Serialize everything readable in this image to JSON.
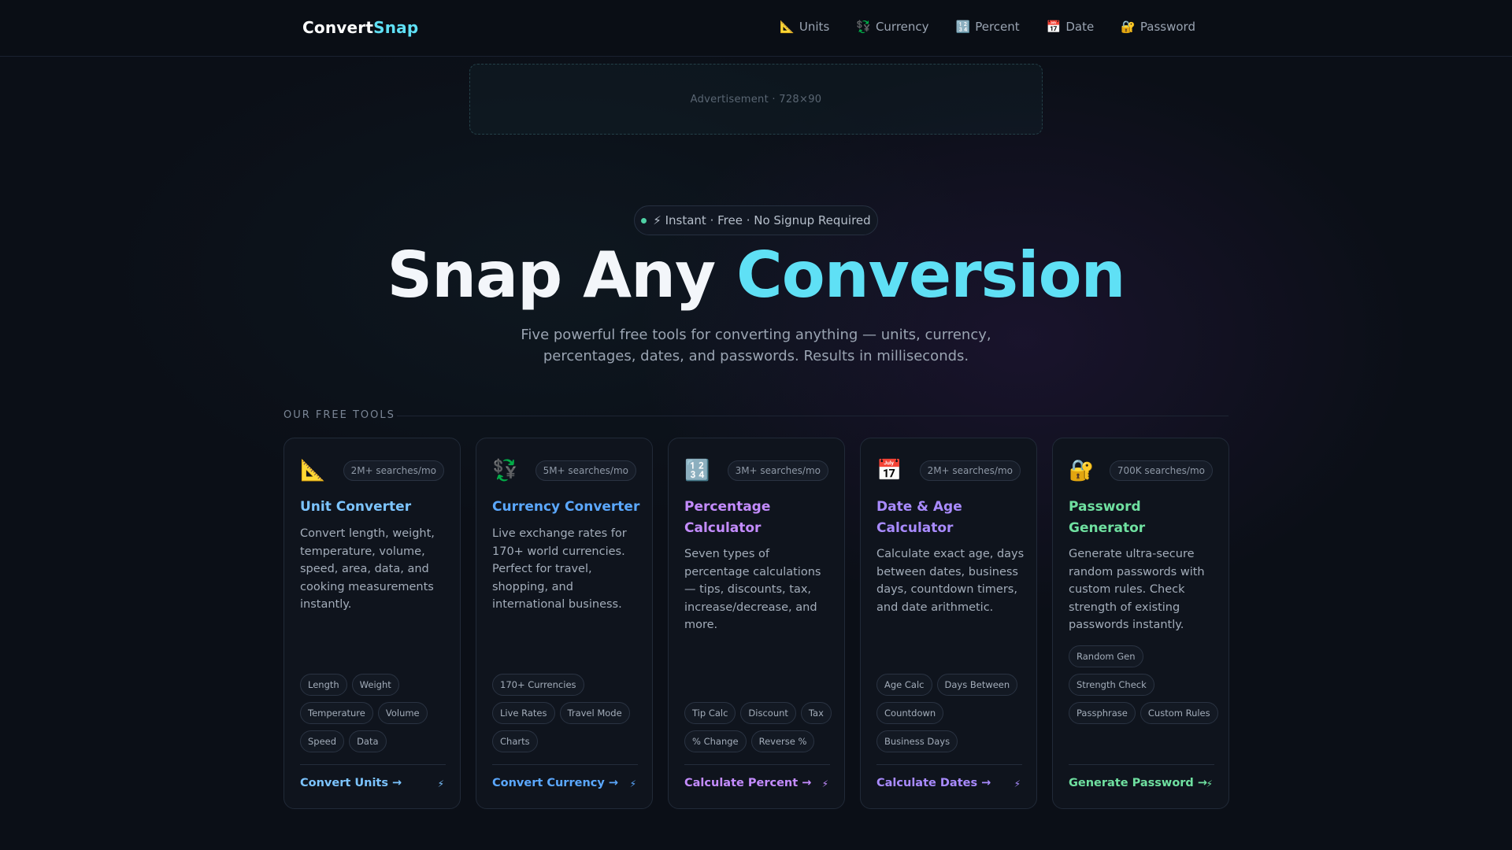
{
  "brand": {
    "part1": "Convert",
    "part2": "Snap"
  },
  "nav": [
    {
      "icon": "📐",
      "label": "Units"
    },
    {
      "icon": "💱",
      "label": "Currency"
    },
    {
      "icon": "🔢",
      "label": "Percent"
    },
    {
      "icon": "📅",
      "label": "Date"
    },
    {
      "icon": "🔐",
      "label": "Password"
    }
  ],
  "ad": {
    "label": "Advertisement · 728×90"
  },
  "hero": {
    "pill": "⚡ Instant · Free · No Signup Required",
    "title_part1": "Snap Any ",
    "title_part2": "Conversion",
    "subtitle": "Five powerful free tools for converting anything — units, currency, percentages, dates, and passwords. Results in milliseconds."
  },
  "section": {
    "label": "OUR FREE TOOLS"
  },
  "colors": {
    "cyan": "#5fe0f5",
    "unit": "#7cc4ff",
    "currency": "#5ba8ff",
    "percent": "#c48cff",
    "date": "#a98bff",
    "password": "#6fe0a0"
  },
  "cards": [
    {
      "icon": "📐",
      "badge": "2M+ searches/mo",
      "title": "Unit Converter",
      "desc": "Convert length, weight, temperature, volume, speed, area, data, and cooking measurements instantly.",
      "tags": [
        "Length",
        "Weight",
        "Temperature",
        "Volume",
        "Speed",
        "Data"
      ],
      "cta": "Convert Units →",
      "bolt": "⚡"
    },
    {
      "icon": "💱",
      "badge": "5M+ searches/mo",
      "title": "Currency Converter",
      "desc": "Live exchange rates for 170+ world currencies. Perfect for travel, shopping, and international business.",
      "tags": [
        "170+ Currencies",
        "Live Rates",
        "Travel Mode",
        "Charts"
      ],
      "cta": "Convert Currency →",
      "bolt": "⚡"
    },
    {
      "icon": "🔢",
      "badge": "3M+ searches/mo",
      "title": "Percentage Calculator",
      "desc": "Seven types of percentage calculations — tips, discounts, tax, increase/decrease, and more.",
      "tags": [
        "Tip Calc",
        "Discount",
        "Tax",
        "% Change",
        "Reverse %"
      ],
      "cta": "Calculate Percent →",
      "bolt": "⚡"
    },
    {
      "icon": "📅",
      "badge": "2M+ searches/mo",
      "title": "Date & Age Calculator",
      "desc": "Calculate exact age, days between dates, business days, countdown timers, and date arithmetic.",
      "tags": [
        "Age Calc",
        "Days Between",
        "Countdown",
        "Business Days"
      ],
      "cta": "Calculate Dates →",
      "bolt": "⚡"
    },
    {
      "icon": "🔐",
      "badge": "700K searches/mo",
      "title": "Password Generator",
      "desc": "Generate ultra-secure random passwords with custom rules. Check strength of existing passwords instantly.",
      "tags": [
        "Random Gen",
        "Strength Check",
        "Passphrase",
        "Custom Rules"
      ],
      "cta": "Generate Password →",
      "bolt": "⚡"
    }
  ]
}
